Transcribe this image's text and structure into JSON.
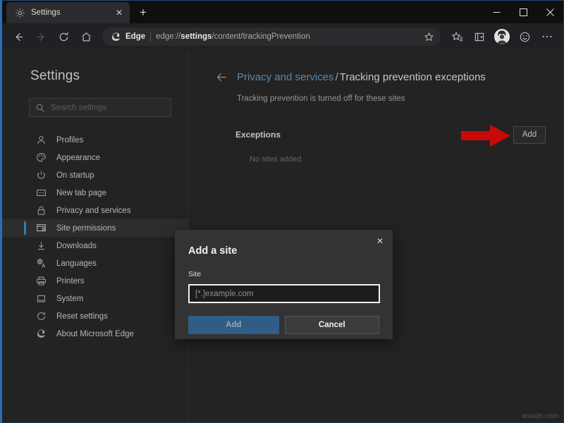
{
  "window": {
    "controls": {
      "minimize": "–",
      "maximize": "□",
      "close": "✕"
    }
  },
  "tabstrip": {
    "tabs": [
      {
        "title": "Settings",
        "favicon": "gear-icon",
        "close_label": "✕"
      }
    ],
    "new_tab_label": "+"
  },
  "toolbar": {
    "back": "←",
    "forward": "→",
    "refresh": "↻",
    "home": "⌂",
    "edge_badge_label": "Edge",
    "url_prefix": "edge://",
    "url_bold": "settings",
    "url_suffix": "/content/trackingPrevention",
    "url_full": "edge://settings/content/trackingPrevention",
    "favorite_star": "☆",
    "favorites_icon": "favorites-star-icon",
    "collections_icon": "collections-icon",
    "profile_icon": "profile-avatar",
    "feedback_icon": "smiley-icon",
    "more_icon": "⋯"
  },
  "sidebar": {
    "title": "Settings",
    "search": {
      "placeholder": "Search settings",
      "value": ""
    },
    "items": [
      {
        "label": "Profiles",
        "icon": "person-icon",
        "active": false
      },
      {
        "label": "Appearance",
        "icon": "palette-icon",
        "active": false
      },
      {
        "label": "On startup",
        "icon": "power-icon",
        "active": false
      },
      {
        "label": "New tab page",
        "icon": "newtab-icon",
        "active": false
      },
      {
        "label": "Privacy and services",
        "icon": "lock-icon",
        "active": false
      },
      {
        "label": "Site permissions",
        "icon": "site-permissions-icon",
        "active": true
      },
      {
        "label": "Downloads",
        "icon": "download-icon",
        "active": false
      },
      {
        "label": "Languages",
        "icon": "languages-icon",
        "active": false
      },
      {
        "label": "Printers",
        "icon": "printer-icon",
        "active": false
      },
      {
        "label": "System",
        "icon": "laptop-icon",
        "active": false
      },
      {
        "label": "Reset settings",
        "icon": "reset-icon",
        "active": false
      },
      {
        "label": "About Microsoft Edge",
        "icon": "edge-logo-icon",
        "active": false
      }
    ]
  },
  "content": {
    "back_arrow": "←",
    "breadcrumb_parent": "Privacy and services",
    "breadcrumb_separator": "/",
    "breadcrumb_current": "Tracking prevention exceptions",
    "description": "Tracking prevention is turned off for these sites",
    "exceptions_title": "Exceptions",
    "add_button": "Add",
    "empty_text": "No sites added",
    "annotation_arrow_color": "#f40d0d"
  },
  "dialog": {
    "title": "Add a site",
    "close_label": "✕",
    "field_label": "Site",
    "input_value": "",
    "input_placeholder": "[*.]example.com",
    "primary_button": "Add",
    "secondary_button": "Cancel",
    "primary_color": "#2f5d85"
  },
  "watermark": "wsxdn.com"
}
